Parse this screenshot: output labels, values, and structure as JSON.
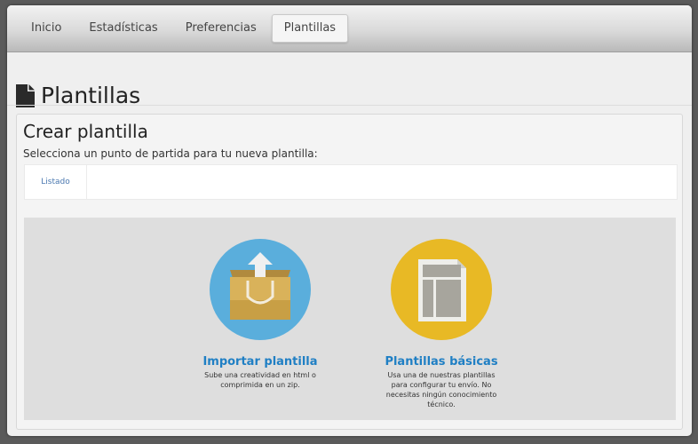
{
  "nav": {
    "tabs": [
      {
        "label": "Inicio"
      },
      {
        "label": "Estadísticas"
      },
      {
        "label": "Preferencias"
      },
      {
        "label": "Plantillas"
      }
    ],
    "active_tab": "Plantillas"
  },
  "page": {
    "title": "Plantillas"
  },
  "panel": {
    "title": "Crear plantilla",
    "subtitle": "Selecciona un punto de partida para tu nueva plantilla:",
    "subtabs": [
      {
        "label": "Listado"
      }
    ]
  },
  "options": [
    {
      "title": "Importar plantilla",
      "description": "Sube una creatividad en html o comprimida en un zip.",
      "icon": "import-box-icon",
      "circle_color": "#5aaedc"
    },
    {
      "title": "Plantillas básicas",
      "description": "Usa una de nuestras plantillas para configurar tu envío. No necesitas ningún conocimiento técnico.",
      "icon": "template-layout-icon",
      "circle_color": "#e8b925"
    }
  ],
  "colors": {
    "link_blue": "#1f7fc4",
    "tab_blue": "#4a78b0"
  }
}
